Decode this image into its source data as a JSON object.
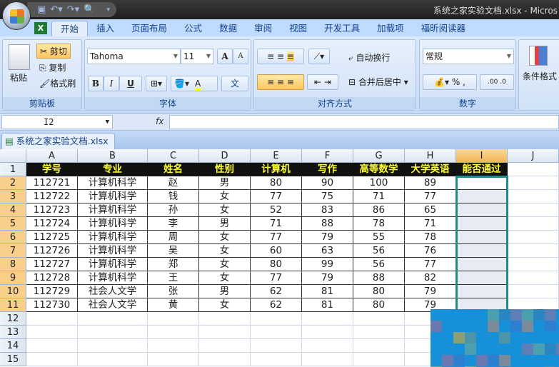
{
  "window": {
    "title": "系统之家实验文档.xlsx - Micros"
  },
  "tabs": [
    "开始",
    "插入",
    "页面布局",
    "公式",
    "数据",
    "审阅",
    "视图",
    "开发工具",
    "加载项",
    "福昕阅读器"
  ],
  "ribbon": {
    "clipboard": {
      "label": "剪贴板",
      "paste": "粘贴",
      "cut": "剪切",
      "copy": "复制",
      "format_painter": "格式刷"
    },
    "font": {
      "label": "字体",
      "font_name": "Tahoma",
      "font_size": "11",
      "bold": "B",
      "italic": "I",
      "underline": "U",
      "grow": "A",
      "shrink": "A",
      "font_color": "A",
      "phonetic": "文"
    },
    "alignment": {
      "label": "对齐方式",
      "wrap": "自动换行",
      "merge": "合并后居中"
    },
    "number": {
      "label": "数字",
      "format": "常规",
      "percent": "%",
      "comma": ",",
      "inc_decimal": ".00",
      "dec_decimal": ".0"
    },
    "styles": {
      "conditional": "条件格式"
    }
  },
  "formula_bar": {
    "name_box": "I2",
    "fx": "fx",
    "value": ""
  },
  "workbook_tab": "系统之家实验文档.xlsx",
  "sheet": {
    "columns": [
      "A",
      "B",
      "C",
      "D",
      "E",
      "F",
      "G",
      "H",
      "I",
      "J"
    ],
    "selected_column": "I",
    "selected_range": "I2:I11",
    "headers": [
      "学号",
      "专业",
      "姓名",
      "性别",
      "计算机",
      "写作",
      "高等数学",
      "大学英语",
      "能否通过"
    ],
    "rows": [
      [
        "112721",
        "计算机科学",
        "赵",
        "男",
        "80",
        "90",
        "100",
        "89",
        ""
      ],
      [
        "112722",
        "计算机科学",
        "钱",
        "女",
        "77",
        "75",
        "71",
        "77",
        ""
      ],
      [
        "112723",
        "计算机科学",
        "孙",
        "女",
        "52",
        "83",
        "86",
        "65",
        ""
      ],
      [
        "112724",
        "计算机科学",
        "李",
        "男",
        "71",
        "88",
        "78",
        "71",
        ""
      ],
      [
        "112725",
        "计算机科学",
        "周",
        "女",
        "77",
        "79",
        "55",
        "78",
        ""
      ],
      [
        "112726",
        "计算机科学",
        "吴",
        "女",
        "60",
        "63",
        "56",
        "76",
        ""
      ],
      [
        "112727",
        "计算机科学",
        "郑",
        "女",
        "80",
        "99",
        "56",
        "77",
        ""
      ],
      [
        "112728",
        "计算机科学",
        "王",
        "女",
        "77",
        "79",
        "88",
        "82",
        ""
      ],
      [
        "112729",
        "社会人文学",
        "张",
        "男",
        "62",
        "81",
        "80",
        "79",
        ""
      ],
      [
        "112730",
        "社会人文学",
        "黄",
        "女",
        "62",
        "81",
        "80",
        "79",
        ""
      ]
    ],
    "row_numbers": [
      "1",
      "2",
      "3",
      "4",
      "5",
      "6",
      "7",
      "8",
      "9",
      "10",
      "11",
      "12",
      "13",
      "14",
      "15"
    ]
  },
  "colors": {
    "header_bg": "#111111",
    "header_text": "#ffff33",
    "selection_border": "#1f8a8a",
    "ribbon_bg": "#dbe8f9"
  }
}
